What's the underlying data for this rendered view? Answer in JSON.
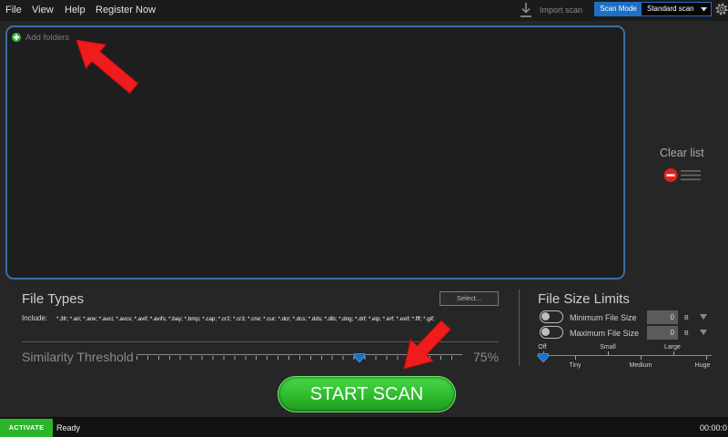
{
  "menu": {
    "items": [
      "File",
      "View",
      "Help",
      "Register Now"
    ]
  },
  "toolbar": {
    "import_icon": "download-icon",
    "import_label": "Import scan",
    "scan_mode_label": "Scan Mode",
    "scan_mode_value": "Standard scan",
    "settings_icon": "gear-icon"
  },
  "drop_zone": {
    "add_icon": "plus-circle-icon",
    "add_folders_label": "Add folders"
  },
  "clear_list": {
    "label": "Clear list",
    "icon": "remove-list-icon"
  },
  "file_types": {
    "title": "File Types",
    "select_label": "Select...",
    "include_label": "Include:",
    "include_value": "*.3fr; *.ari; *.arw; *.avci; *.avcs; *.avif; *.avifs; *.bay; *.bmp; *.cap; *.cr2; *.cr3; *.crw; *.cur; *.dcr; *.dcs; *.dds; *.dib; *.dng; *.drf; *.eip; *.erf; *.exif; *.fff; *.gif;"
  },
  "similarity": {
    "label": "Similarity Threshold",
    "value": 75,
    "value_label": "75%"
  },
  "size_limits": {
    "title": "File Size Limits",
    "rows": [
      {
        "label": "Minimum File Size",
        "value": "0",
        "unit": "B",
        "enabled": false
      },
      {
        "label": "Maximum File Size",
        "value": "0",
        "unit": "B",
        "enabled": false
      }
    ],
    "slider": {
      "labels_top": [
        "Off",
        "Small",
        "Large"
      ],
      "labels_bottom": [
        "Tiny",
        "Medium",
        "Huge"
      ],
      "selected_index": 0
    }
  },
  "start_scan": {
    "label": "START SCAN"
  },
  "status": {
    "activate_label": "ACTIVATE",
    "status_text": "Ready",
    "timer": "00:00:0"
  },
  "colors": {
    "accent_blue": "#1f6fc5",
    "drop_zone_border": "#3a6ea8",
    "start_green": "#2fbf2f",
    "activate_green": "#2ab52a",
    "clear_red": "#e02020",
    "annotation_red": "#ee1c1c"
  }
}
